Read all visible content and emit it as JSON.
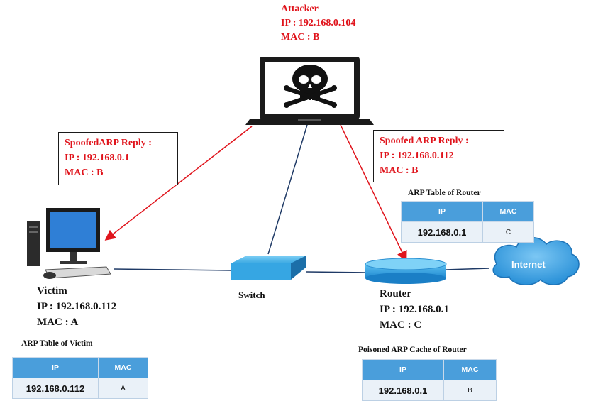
{
  "attacker": {
    "title": "Attacker",
    "ip": "IP : 192.168.0.104",
    "mac": "MAC : B"
  },
  "spoof_left": {
    "title": "SpoofedARP Reply :",
    "ip": "IP : 192.168.0.1",
    "mac": "MAC : B"
  },
  "spoof_right": {
    "title": "Spoofed ARP Reply :",
    "ip": "IP : 192.168.0.112",
    "mac": "MAC : B"
  },
  "victim": {
    "name": "Victim",
    "ip": "IP : 192.168.0.112",
    "mac": "MAC : A"
  },
  "switch": {
    "name": "Switch"
  },
  "router": {
    "name": "Router",
    "ip": "IP : 192.168.0.1",
    "mac": "MAC : C"
  },
  "internet": {
    "name": "Internet"
  },
  "arp_router": {
    "caption": "ARP Table of Router",
    "col_ip": "IP",
    "col_mac": "MAC",
    "ip": "192.168.0.1",
    "mac": "C"
  },
  "arp_victim": {
    "caption": "ARP Table of Victim",
    "col_ip": "IP",
    "col_mac": "MAC",
    "ip": "192.168.0.112",
    "mac": "A"
  },
  "arp_poisoned": {
    "caption": "Poisoned ARP Cache of Router",
    "col_ip": "IP",
    "col_mac": "MAC",
    "ip": "192.168.0.1",
    "mac": "B"
  },
  "colors": {
    "spoof": "#e0141c",
    "wire": "#1f3a66",
    "table_header": "#4a9edb",
    "switch": "#38a9e4",
    "cloud": "#3aa6e6"
  }
}
